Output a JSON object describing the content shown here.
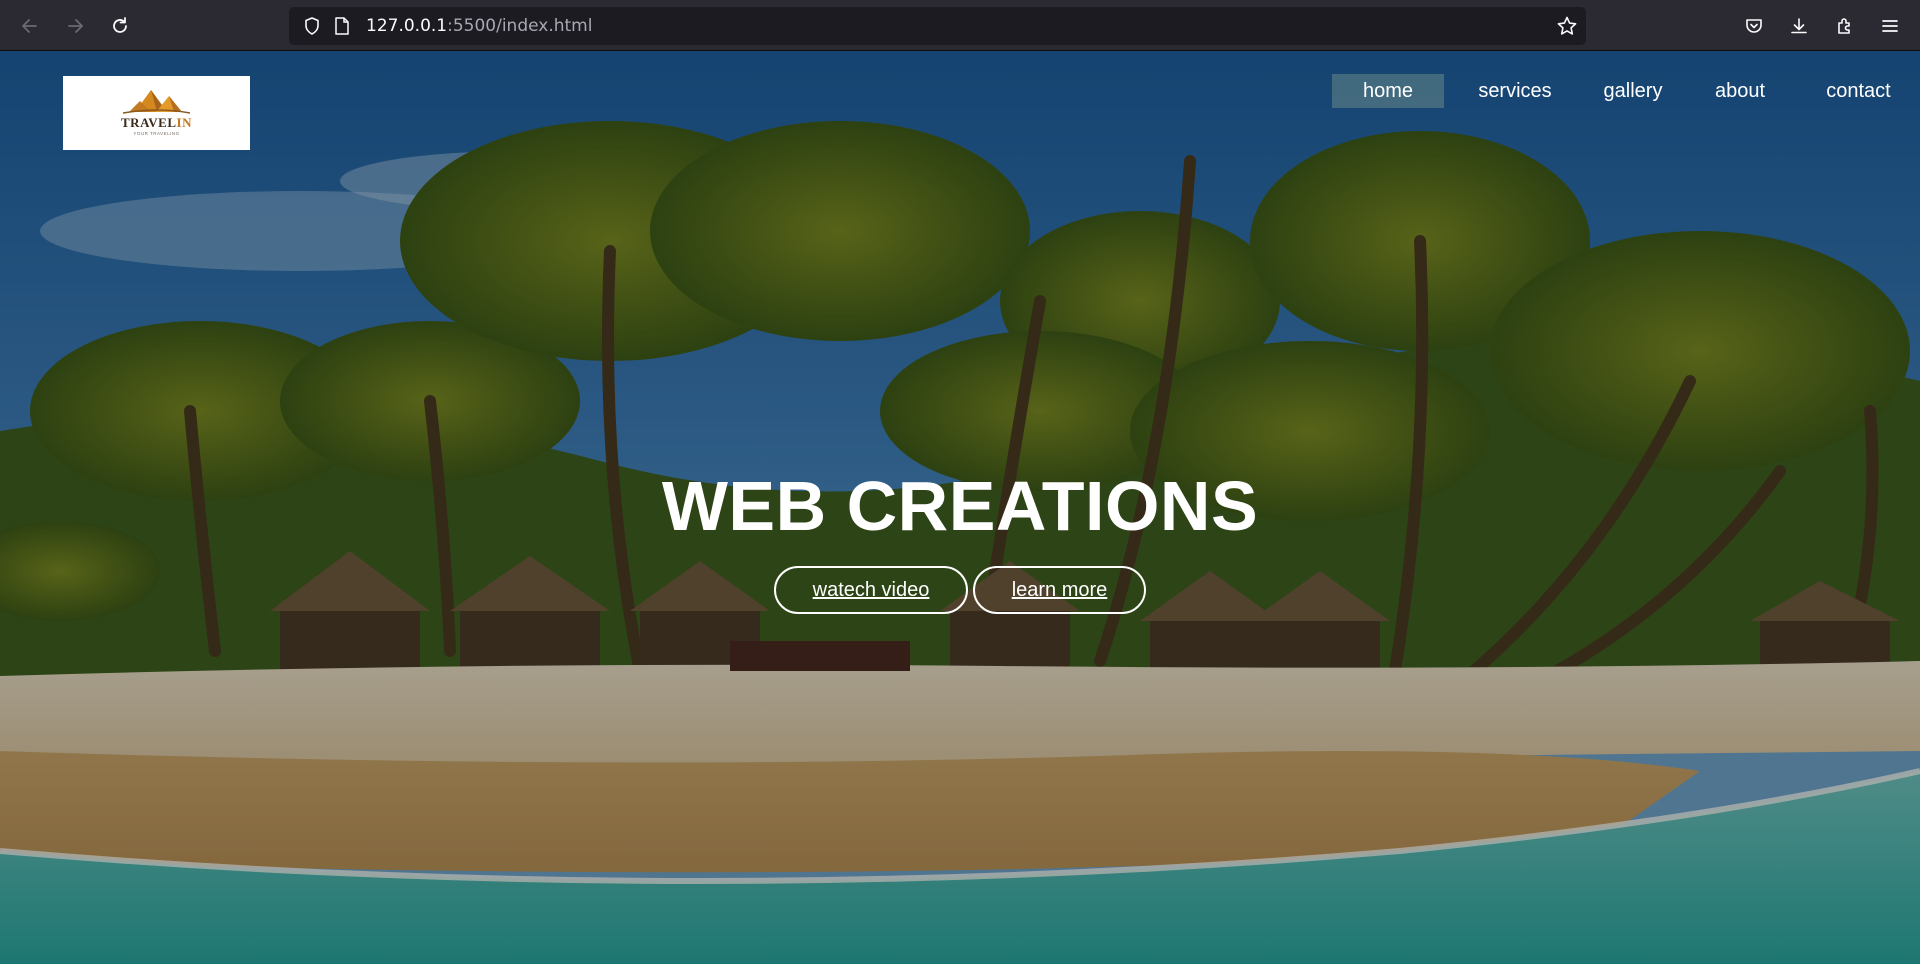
{
  "browser": {
    "url_host": "127.0.0.1",
    "url_rest": ":5500/index.html",
    "icons": [
      "back-arrow-icon",
      "forward-arrow-icon",
      "reload-icon",
      "shield-icon",
      "page-icon",
      "star-icon",
      "pocket-icon",
      "download-icon",
      "extensions-icon",
      "menu-icon"
    ]
  },
  "site": {
    "logo": {
      "title_main": "TRAVEL",
      "title_accent": "IN",
      "subtitle": "YOUR TRAVELING"
    },
    "nav": [
      "home",
      "services",
      "gallery",
      "about",
      "contact"
    ],
    "active_nav": "home",
    "hero": {
      "title": "WEB CREATIONS",
      "buttons": [
        "watech video",
        "learn more"
      ]
    }
  },
  "colors": {
    "chrome_bg": "#2b2a33",
    "urlbar_bg": "#1c1b22",
    "hero_text": "#ffffff",
    "logo_accent": "#c7761f"
  }
}
